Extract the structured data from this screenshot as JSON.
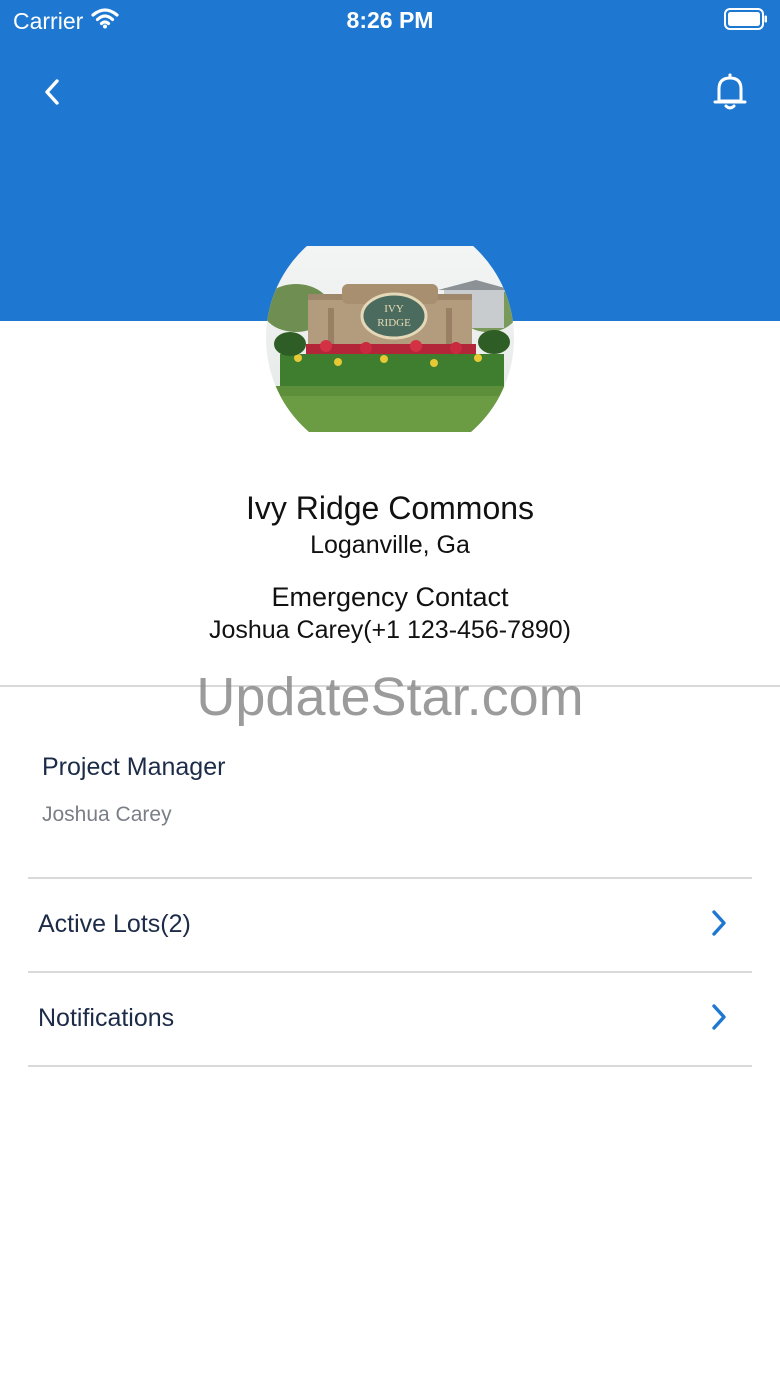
{
  "status_bar": {
    "carrier": "Carrier",
    "time": "8:26 PM",
    "wifi_icon": "wifi-icon",
    "battery_icon": "battery-icon"
  },
  "header": {
    "background_color": "#1e77d0",
    "back_icon": "chevron-left-icon",
    "bell_icon": "bell-icon"
  },
  "community": {
    "image_sign_text": "IVY RIDGE",
    "name": "Ivy Ridge Commons",
    "location": "Loganville, Ga"
  },
  "emergency_contact": {
    "heading": "Emergency Contact",
    "value": "Joshua Carey(+1 123-456-7890)"
  },
  "watermark": "UpdateStar.com",
  "project_manager": {
    "label": "Project Manager",
    "value": "Joshua Carey"
  },
  "menu": {
    "items": [
      {
        "label": "Active Lots(2)",
        "icon": "chevron-right-icon"
      },
      {
        "label": "Notifications",
        "icon": "chevron-right-icon"
      }
    ]
  },
  "colors": {
    "accent": "#1e77d0",
    "text_dark": "#1c2b48",
    "text_muted": "#7a7f87",
    "divider": "#d9d9d9"
  }
}
